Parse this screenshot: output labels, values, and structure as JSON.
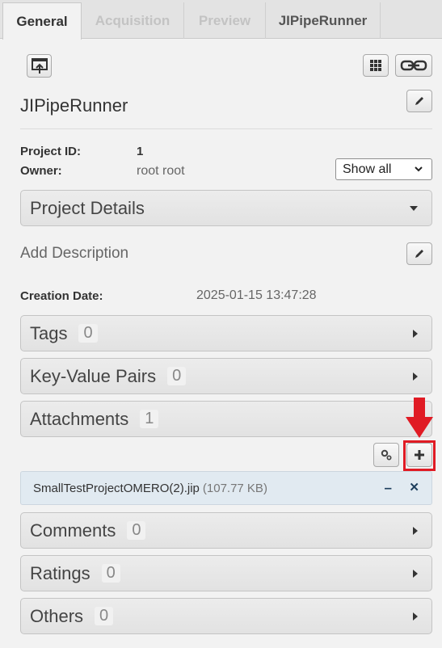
{
  "tabs": [
    {
      "label": "General",
      "state": "active"
    },
    {
      "label": "Acquisition",
      "state": "disabled"
    },
    {
      "label": "Preview",
      "state": "disabled"
    },
    {
      "label": "JIPipeRunner",
      "state": "normal"
    }
  ],
  "project": {
    "name": "JIPipeRunner",
    "id_label": "Project ID:",
    "id_value": "1",
    "owner_label": "Owner:",
    "owner_value": "root root",
    "show_select": "Show all"
  },
  "details_panel": {
    "label": "Project Details"
  },
  "description_placeholder": "Add Description",
  "creation": {
    "label": "Creation Date:",
    "value": "2025-01-15 13:47:28"
  },
  "sections": {
    "tags": {
      "label": "Tags",
      "count": "0"
    },
    "kv": {
      "label": "Key-Value Pairs",
      "count": "0"
    },
    "attachments": {
      "label": "Attachments",
      "count": "1"
    },
    "comments": {
      "label": "Comments",
      "count": "0"
    },
    "ratings": {
      "label": "Ratings",
      "count": "0"
    },
    "others": {
      "label": "Others",
      "count": "0"
    }
  },
  "attachment_file": {
    "name": "SmallTestProjectOMERO(2).jip",
    "size": "(107.77 KB)"
  },
  "icons": {
    "open": "open-in-window-icon",
    "grid": "grid-icon",
    "link": "link-icon",
    "edit": "pencil-icon",
    "gears": "gears-icon",
    "add": "plus-icon",
    "remove": "minus-icon",
    "delete": "x-icon",
    "arrow": "red-arrow-down-icon"
  },
  "colors": {
    "annotation_red": "#e01b24",
    "file_row_bg": "#e1eaf1",
    "file_action": "#1d3e5c"
  }
}
